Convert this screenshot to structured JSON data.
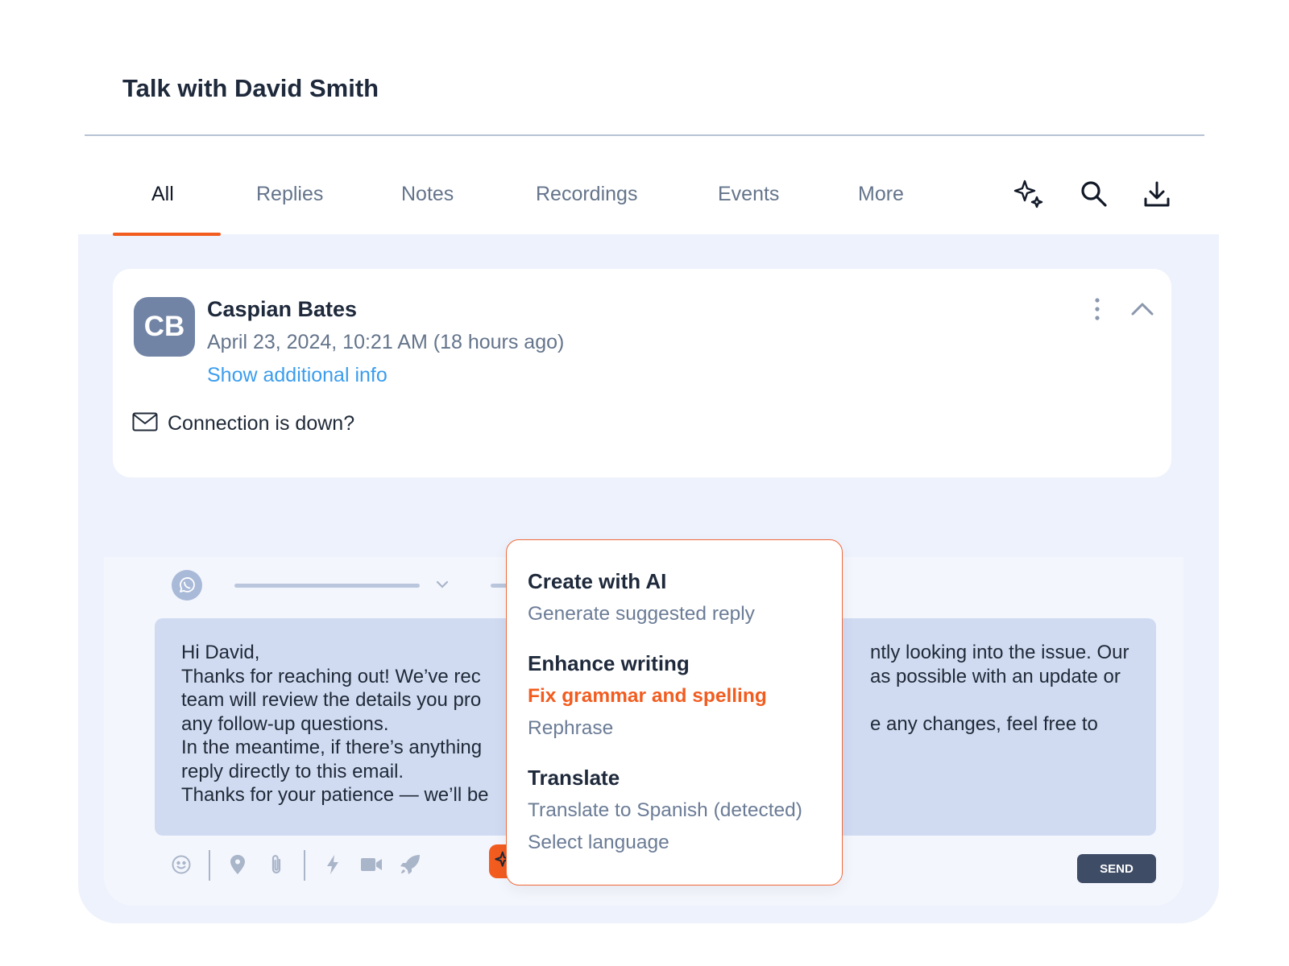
{
  "conversation": {
    "title": "Talk with David Smith"
  },
  "tabs": [
    {
      "label": "All",
      "active": true
    },
    {
      "label": "Replies",
      "active": false
    },
    {
      "label": "Notes",
      "active": false
    },
    {
      "label": "Recordings",
      "active": false
    },
    {
      "label": "Events",
      "active": false
    },
    {
      "label": "More",
      "active": false
    }
  ],
  "toolbar_icons": [
    "sparkles-icon",
    "search-icon",
    "download-icon"
  ],
  "message": {
    "avatar_initials": "CB",
    "sender": "Caspian Bates",
    "timestamp": "April 23, 2024, 10:21 AM (18 hours ago)",
    "more_info": "Show additional info",
    "subject": "Connection is down?"
  },
  "reply": {
    "lines": [
      "Hi David,",
      "Thanks for reaching out! We’ve rec",
      "team will review the details you pro",
      "any follow-up questions.",
      "In the meantime, if there’s anything",
      "reply directly to this email.",
      "Thanks for your patience — we’ll be"
    ],
    "lines_right": [
      "",
      "ntly looking into the issue. Our",
      "as possible with an update or",
      "",
      "e any changes, feel free to",
      "",
      ""
    ],
    "send_label": "SEND"
  },
  "ai_menu": {
    "create_heading": "Create with AI",
    "generate": "Generate suggested reply",
    "enhance_heading": "Enhance writing",
    "fix_grammar": "Fix grammar and spelling",
    "rephrase": "Rephrase",
    "translate_heading": "Translate",
    "translate_detected": "Translate to Spanish (detected)",
    "select_language": "Select language"
  },
  "colors": {
    "accent": "#f25c1f",
    "link": "#3b9ded",
    "avatar": "#7184a6",
    "send": "#3e4c66",
    "panel": "#eef2fc"
  }
}
